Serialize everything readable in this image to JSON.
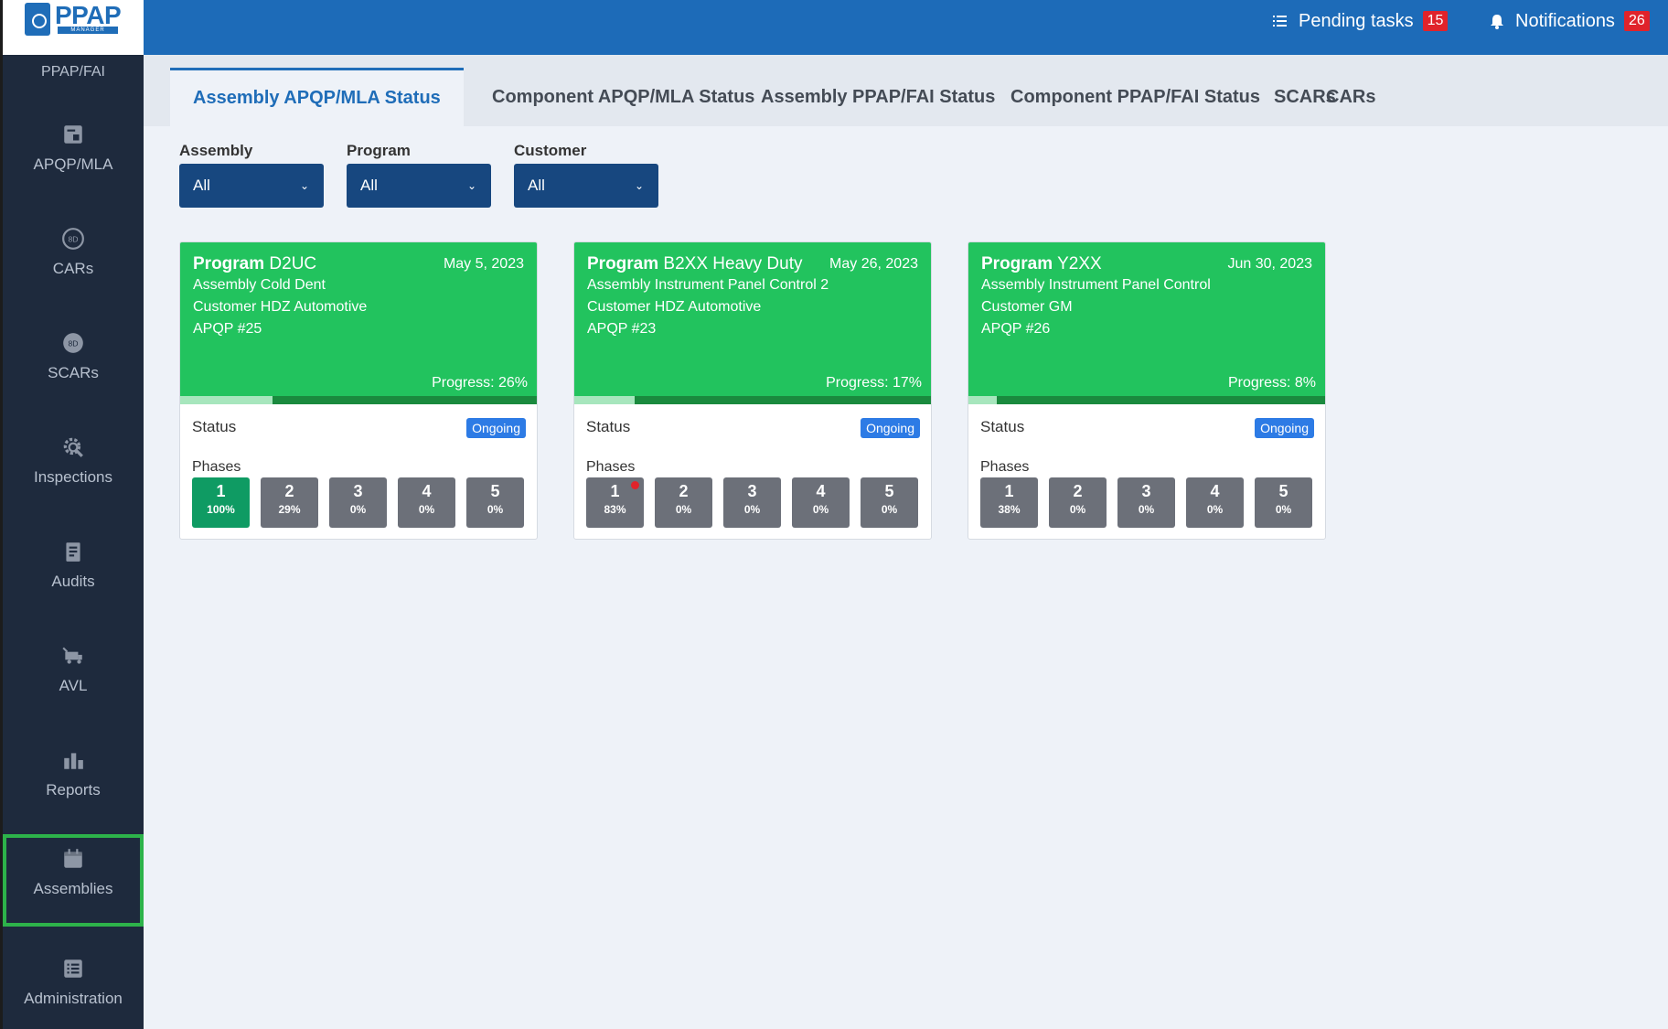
{
  "logo": {
    "text": "PPAP",
    "sub": "MANAGER"
  },
  "sidebar": {
    "top_label": "PPAP/FAI",
    "items": [
      {
        "label": "APQP/MLA",
        "icon": "document-icon"
      },
      {
        "label": "CARs",
        "icon": "8d-icon"
      },
      {
        "label": "SCARs",
        "icon": "8d-icon"
      },
      {
        "label": "Inspections",
        "icon": "gear-magnifier-icon"
      },
      {
        "label": "Audits",
        "icon": "clipboard-icon"
      },
      {
        "label": "AVL",
        "icon": "truck-icon"
      },
      {
        "label": "Reports",
        "icon": "bar-chart-icon"
      },
      {
        "label": "Assemblies",
        "icon": "calendar-icon",
        "active": true
      },
      {
        "label": "Administration",
        "icon": "list-icon"
      }
    ]
  },
  "header": {
    "pending_label": "Pending tasks",
    "pending_count": "15",
    "notifications_label": "Notifications",
    "notifications_count": "26"
  },
  "tabs": [
    {
      "label": "Assembly APQP/MLA Status",
      "active": true
    },
    {
      "label": "Component APQP/MLA Status"
    },
    {
      "label": "Assembly PPAP/FAI Status"
    },
    {
      "label": "Component PPAP/FAI Status"
    },
    {
      "label": "SCARs"
    },
    {
      "label": "CARs"
    }
  ],
  "filters": [
    {
      "label": "Assembly",
      "value": "All"
    },
    {
      "label": "Program",
      "value": "All"
    },
    {
      "label": "Customer",
      "value": "All"
    }
  ],
  "cards": [
    {
      "program_prefix": "Program",
      "program": "D2UC",
      "date": "May 5, 2023",
      "assembly": "Assembly Cold Dent",
      "customer": "Customer HDZ Automotive",
      "apqp": "APQP #25",
      "progress_label": "Progress: 26%",
      "progress": 0.26,
      "status_label": "Status",
      "status": "Ongoing",
      "phases_label": "Phases",
      "phases": [
        {
          "n": "1",
          "pct": "100%",
          "done": true
        },
        {
          "n": "2",
          "pct": "29%"
        },
        {
          "n": "3",
          "pct": "0%"
        },
        {
          "n": "4",
          "pct": "0%"
        },
        {
          "n": "5",
          "pct": "0%"
        }
      ]
    },
    {
      "program_prefix": "Program",
      "program": "B2XX Heavy Duty",
      "date": "May 26, 2023",
      "assembly": "Assembly Instrument Panel Control 2",
      "customer": "Customer HDZ Automotive",
      "apqp": "APQP #23",
      "progress_label": "Progress: 17%",
      "progress": 0.17,
      "status_label": "Status",
      "status": "Ongoing",
      "phases_label": "Phases",
      "phases": [
        {
          "n": "1",
          "pct": "83%",
          "alert": true
        },
        {
          "n": "2",
          "pct": "0%"
        },
        {
          "n": "3",
          "pct": "0%"
        },
        {
          "n": "4",
          "pct": "0%"
        },
        {
          "n": "5",
          "pct": "0%"
        }
      ]
    },
    {
      "program_prefix": "Program",
      "program": "Y2XX",
      "date": "Jun 30, 2023",
      "assembly": "Assembly Instrument Panel Control",
      "customer": "Customer GM",
      "apqp": "APQP #26",
      "progress_label": "Progress: 8%",
      "progress": 0.08,
      "status_label": "Status",
      "status": "Ongoing",
      "phases_label": "Phases",
      "phases": [
        {
          "n": "1",
          "pct": "38%"
        },
        {
          "n": "2",
          "pct": "0%"
        },
        {
          "n": "3",
          "pct": "0%"
        },
        {
          "n": "4",
          "pct": "0%"
        },
        {
          "n": "5",
          "pct": "0%"
        }
      ]
    }
  ],
  "colors": {
    "header": "#1d6bb8",
    "sidebar": "#1e2a3d",
    "card_head": "#22c35e",
    "badge": "#2d7be5",
    "phase_done": "#0f9b63",
    "alert": "#e0232b"
  }
}
